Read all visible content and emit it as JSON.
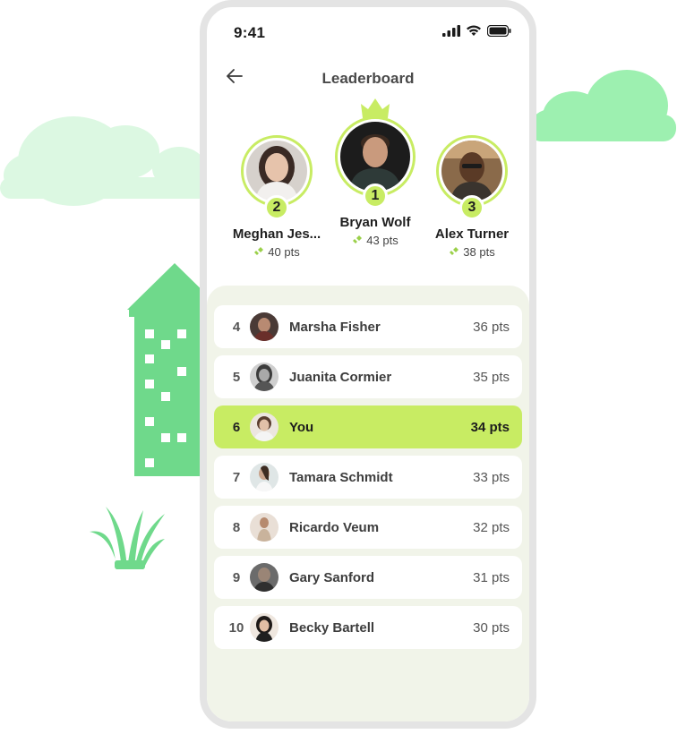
{
  "status": {
    "time": "9:41"
  },
  "header": {
    "title": "Leaderboard"
  },
  "podium": [
    {
      "rank": "2",
      "name": "Meghan Jes...",
      "points": "40 pts"
    },
    {
      "rank": "1",
      "name": "Bryan Wolf",
      "points": "43 pts"
    },
    {
      "rank": "3",
      "name": "Alex Turner",
      "points": "38 pts"
    }
  ],
  "list": [
    {
      "rank": "4",
      "name": "Marsha Fisher",
      "points": "36 pts"
    },
    {
      "rank": "5",
      "name": "Juanita Cormier",
      "points": "35 pts"
    },
    {
      "rank": "6",
      "name": "You",
      "points": "34 pts"
    },
    {
      "rank": "7",
      "name": "Tamara Schmidt",
      "points": "33 pts"
    },
    {
      "rank": "8",
      "name": "Ricardo Veum",
      "points": "32 pts"
    },
    {
      "rank": "9",
      "name": "Gary Sanford",
      "points": "31 pts"
    },
    {
      "rank": "10",
      "name": "Becky Bartell",
      "points": "30 pts"
    }
  ],
  "colors": {
    "accent": "#c8ec63",
    "panel": "#f1f4e9",
    "scenery_green": "#6fd98b",
    "cloud_light": "#dcf8e2",
    "cloud_mid": "#9df0b0"
  },
  "icons": [
    "back-arrow-icon",
    "signal-icon",
    "wifi-icon",
    "battery-icon",
    "crown-icon",
    "points-icon"
  ]
}
